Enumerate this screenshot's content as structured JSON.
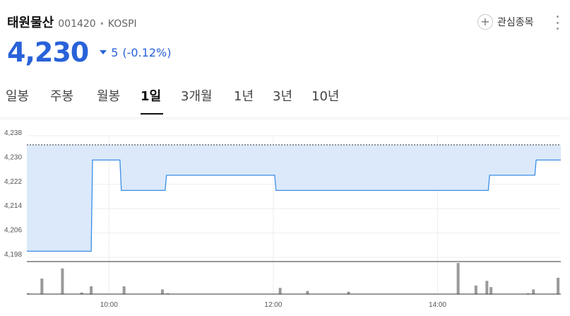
{
  "stock": {
    "name": "태원물산",
    "code": "001420",
    "separator": "•",
    "market": "KOSPI"
  },
  "actions": {
    "watchlist_label": "관심종목",
    "plus_glyph": "+"
  },
  "price": {
    "current": "4,230",
    "change": "5",
    "change_pct": "(-0.12%)",
    "direction": "down"
  },
  "colors": {
    "price": "#2962d9",
    "fill": "#dbe9fb",
    "line": "#3a8ee6",
    "volume": "#9a9a9a"
  },
  "tabs": [
    {
      "label": "일봉"
    },
    {
      "label": "주봉"
    },
    {
      "label": "월봉"
    },
    {
      "label": "1일",
      "active": true
    },
    {
      "label": "3개월"
    },
    {
      "label": "1년"
    },
    {
      "label": "3년"
    },
    {
      "label": "10년"
    }
  ],
  "chart_data": {
    "type": "area",
    "ylim": [
      4198,
      4238
    ],
    "yticks": [
      4238,
      4230,
      4222,
      4214,
      4206,
      4198
    ],
    "ytick_labels": [
      "4,238",
      "4,230",
      "4,222",
      "4,214",
      "4,206",
      "4,198"
    ],
    "xlim": [
      "09:00",
      "15:30"
    ],
    "xticks": [
      "10:00",
      "12:00",
      "14:00"
    ],
    "reference_price": 4235,
    "series": [
      {
        "x": [
          "09:00",
          "09:47",
          "09:48",
          "10:08",
          "10:09",
          "10:41",
          "10:42",
          "12:01",
          "12:02",
          "14:37",
          "14:38",
          "15:11",
          "15:12",
          "15:30"
        ],
        "y": [
          4200,
          4200,
          4230,
          4230,
          4220,
          4220,
          4225,
          4225,
          4220,
          4220,
          4225,
          4225,
          4230,
          4230
        ]
      }
    ],
    "volume": {
      "x": [
        "09:01",
        "09:11",
        "09:26",
        "09:40",
        "09:47",
        "10:11",
        "10:39",
        "10:43",
        "12:05",
        "12:25",
        "12:55",
        "14:15",
        "14:28",
        "14:36",
        "14:39",
        "15:06",
        "15:10",
        "15:28"
      ],
      "values": [
        1,
        20,
        33,
        2,
        10,
        10,
        6,
        1,
        8,
        4,
        3,
        40,
        11,
        17,
        9,
        1,
        6,
        21
      ]
    }
  }
}
